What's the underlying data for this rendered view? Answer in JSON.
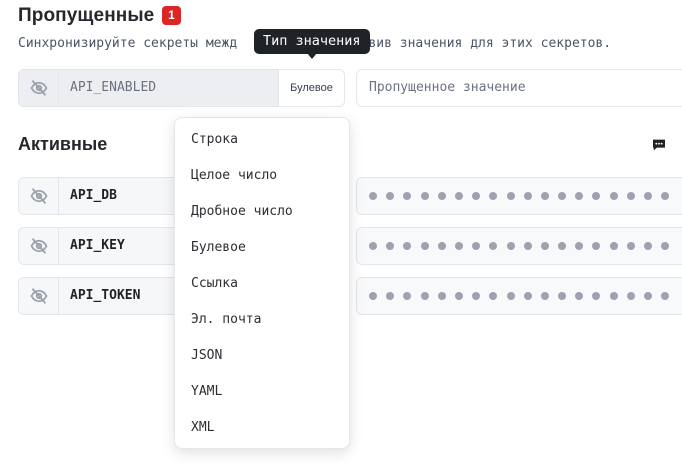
{
  "missing": {
    "title": "Пропущенные",
    "count": "1",
    "description_left": "Синхронизируйте секреты межд",
    "description_right": "добавив значения для этих секретов.",
    "tooltip": "Тип значения",
    "row": {
      "key": "API_ENABLED",
      "type": "Булевое",
      "placeholder": "Пропущенное значение"
    }
  },
  "active": {
    "title": "Активные",
    "rows": [
      {
        "key": "API_DB"
      },
      {
        "key": "API_KEY"
      },
      {
        "key": "API_TOKEN"
      }
    ]
  },
  "dropdown": {
    "options": [
      "Строка",
      "Целое число",
      "Дробное число",
      "Булевое",
      "Ссылка",
      "Эл. почта",
      "JSON",
      "YAML",
      "XML"
    ]
  },
  "icons": {
    "visibility": "eye-off-icon",
    "comment": "comment-icon"
  },
  "colors": {
    "badge": "#dc2626",
    "tooltip": "#1f2328",
    "dot": "#9ca3af"
  }
}
